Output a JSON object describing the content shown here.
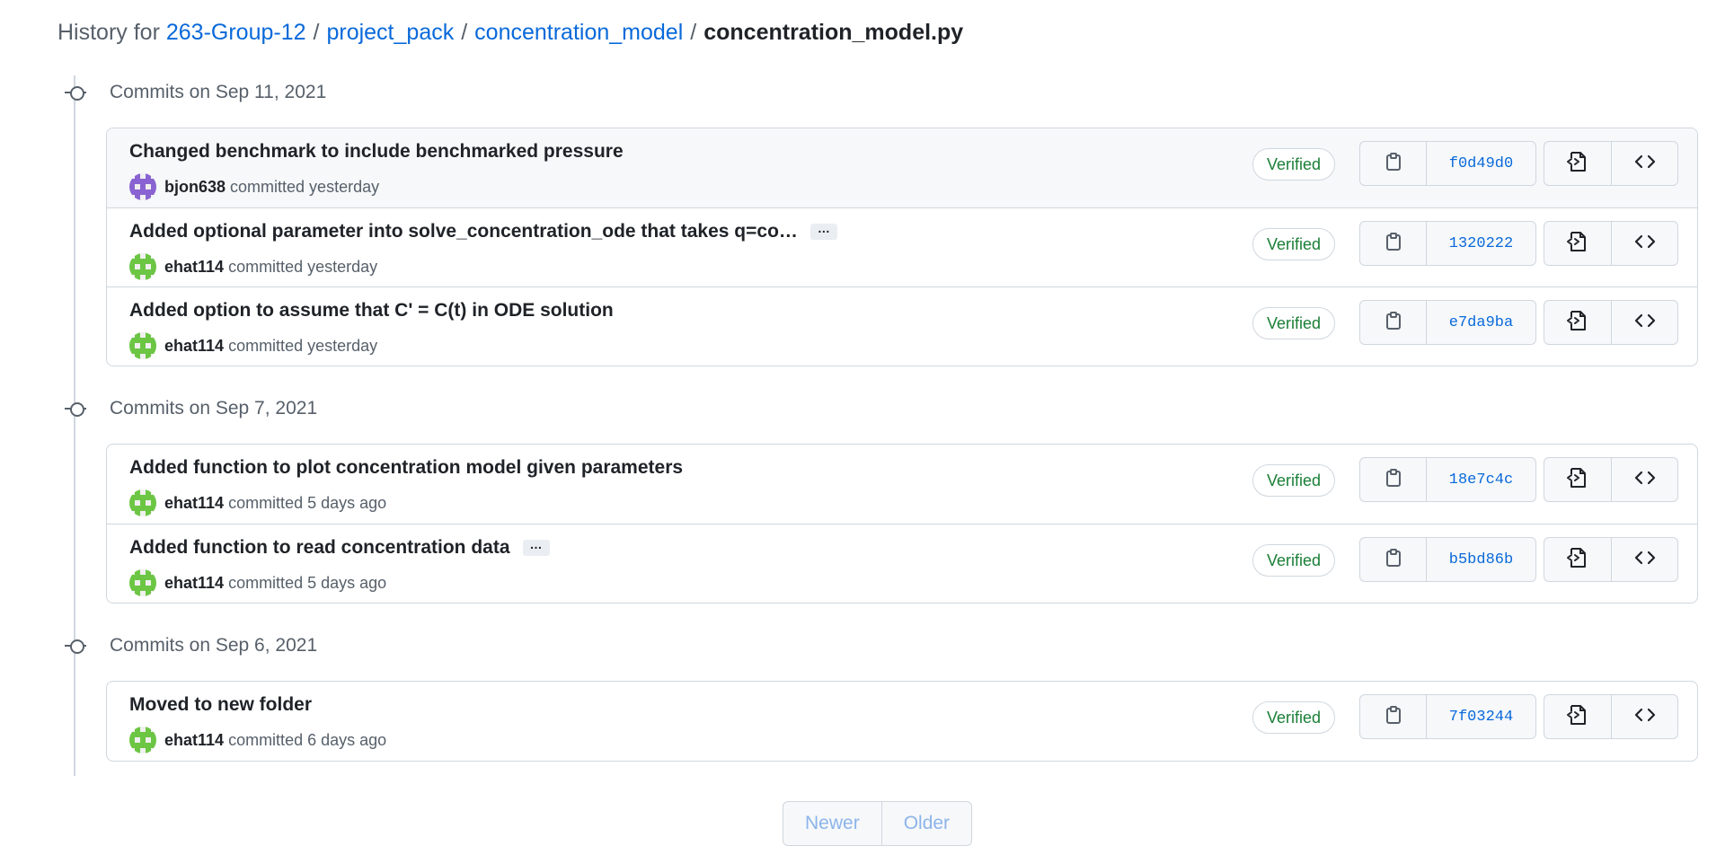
{
  "breadcrumb": {
    "prefix": "History for",
    "repo": "263-Group-12",
    "path": [
      "project_pack",
      "concentration_model"
    ],
    "file": "concentration_model.py",
    "separator": "/"
  },
  "groups": [
    {
      "title": "Commits on Sep 11, 2021",
      "commits": [
        {
          "message": "Changed benchmark to include benchmarked pressure",
          "author": "bjon638",
          "time": "committed yesterday",
          "status": "Verified",
          "sha": "f0d49d0",
          "has_more": false
        },
        {
          "message": "Added optional parameter into solve_concentration_ode that takes q=co…",
          "author": "ehat114",
          "time": "committed yesterday",
          "status": "Verified",
          "sha": "1320222",
          "has_more": true
        },
        {
          "message": "Added option to assume that C' = C(t) in ODE solution",
          "author": "ehat114",
          "time": "committed yesterday",
          "status": "Verified",
          "sha": "e7da9ba",
          "has_more": false
        }
      ]
    },
    {
      "title": "Commits on Sep 7, 2021",
      "commits": [
        {
          "message": "Added function to plot concentration model given parameters",
          "author": "ehat114",
          "time": "committed 5 days ago",
          "status": "Verified",
          "sha": "18e7c4c",
          "has_more": false
        },
        {
          "message": "Added function to read concentration data",
          "author": "ehat114",
          "time": "committed 5 days ago",
          "status": "Verified",
          "sha": "b5bd86b",
          "has_more": true
        }
      ]
    },
    {
      "title": "Commits on Sep 6, 2021",
      "commits": [
        {
          "message": "Moved to new folder",
          "author": "ehat114",
          "time": "committed 6 days ago",
          "status": "Verified",
          "sha": "7f03244",
          "has_more": false
        }
      ]
    }
  ],
  "ellipsis_label": "…",
  "pagination": {
    "newer": "Newer",
    "older": "Older"
  },
  "colors": {
    "link": "#0969da",
    "verified": "#1a7f37",
    "disabled": "#8cb4ea",
    "avatar_bjon638": "#8a63d2",
    "avatar_ehat114": "#6cc644"
  },
  "icons": {
    "copy": "clipboard-icon",
    "browse_file": "file-code-icon",
    "browse_repo": "code-icon",
    "commit_node": "git-commit-icon"
  }
}
